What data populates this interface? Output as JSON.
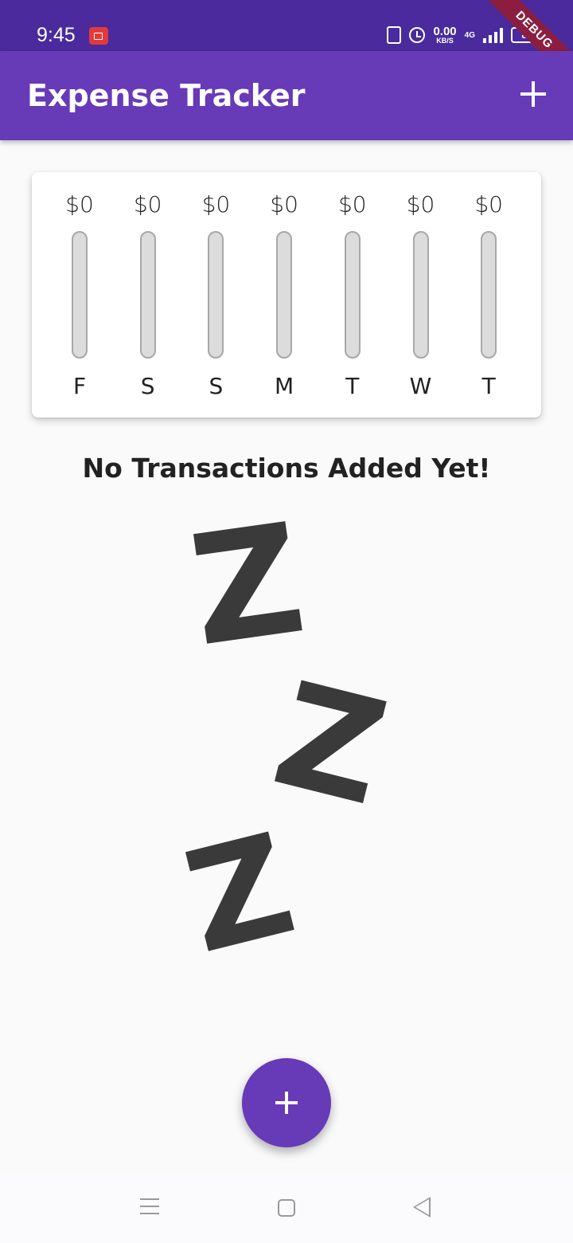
{
  "status_bar": {
    "time": "9:45",
    "net_speed_value": "0.00",
    "net_speed_unit": "KB/S",
    "network_type": "4G",
    "battery": "88",
    "debug_label": "DEBUG"
  },
  "app_bar": {
    "title": "Expense Tracker",
    "add_icon": "plus-icon"
  },
  "weekly_chart": {
    "bars": [
      {
        "day": "F",
        "amount": "$0",
        "fraction": 0
      },
      {
        "day": "S",
        "amount": "$0",
        "fraction": 0
      },
      {
        "day": "S",
        "amount": "$0",
        "fraction": 0
      },
      {
        "day": "M",
        "amount": "$0",
        "fraction": 0
      },
      {
        "day": "T",
        "amount": "$0",
        "fraction": 0
      },
      {
        "day": "W",
        "amount": "$0",
        "fraction": 0
      },
      {
        "day": "T",
        "amount": "$0",
        "fraction": 0
      }
    ],
    "fill_color": "#673ab7"
  },
  "empty_state": {
    "title": "No Transactions Added Yet!",
    "image_letters": [
      "Z",
      "Z",
      "Z"
    ]
  },
  "fab": {
    "icon": "plus-icon"
  },
  "colors": {
    "primary": "#673ab7",
    "status_bar": "#4a2a9c",
    "background": "#fafafa"
  }
}
